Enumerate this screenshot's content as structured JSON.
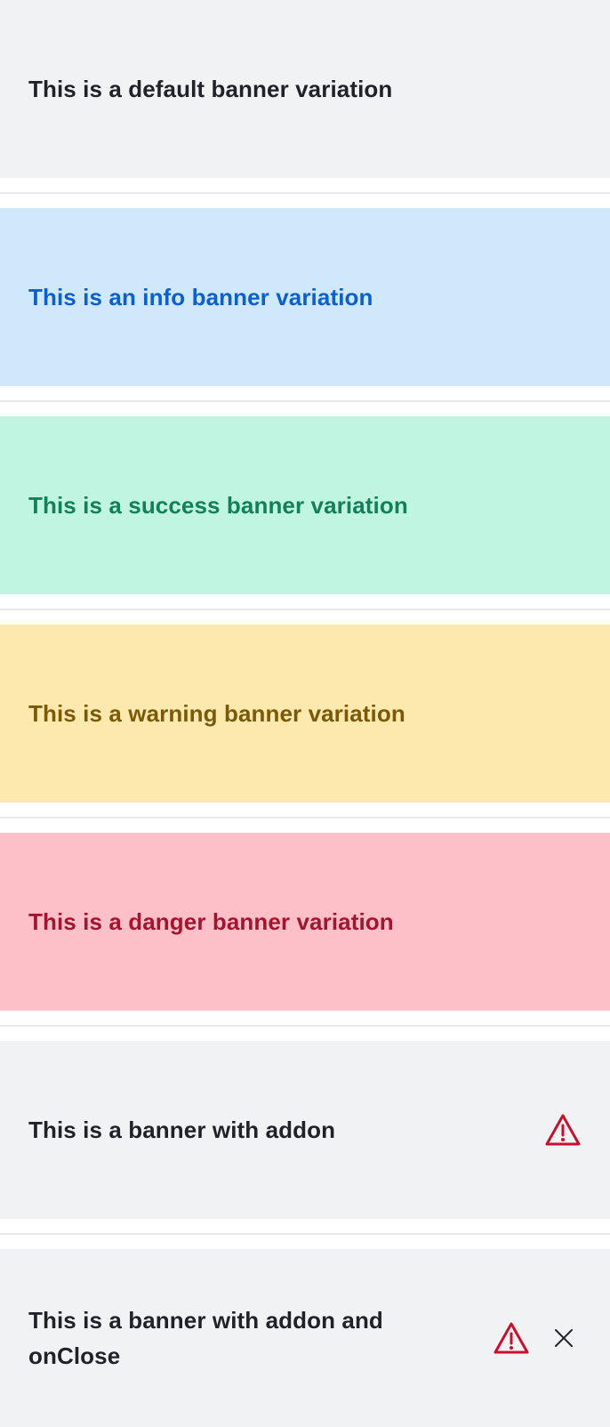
{
  "banners": {
    "default": {
      "text": "This is a default banner variation"
    },
    "info": {
      "text": "This is an info banner variation"
    },
    "success": {
      "text": "This is a success banner variation"
    },
    "warning": {
      "text": "This is a warning banner variation"
    },
    "danger": {
      "text": "This is a danger banner variation"
    },
    "addon": {
      "text": "This is a banner with addon",
      "icon": "warning-triangle-icon"
    },
    "addon_close": {
      "text": "This is a banner with addon and onClose",
      "icon": "warning-triangle-icon",
      "close_icon": "close-icon"
    }
  },
  "colors": {
    "default_bg": "#f1f2f4",
    "info_bg": "#cfe8fc",
    "info_text": "#0b5fcf",
    "success_bg": "#c0f5e2",
    "success_text": "#13805c",
    "warning_bg": "#fde9ad",
    "warning_text": "#7a5a08",
    "danger_bg": "#fdc0c8",
    "danger_text": "#a3142f",
    "alert_icon": "#c8102e"
  }
}
